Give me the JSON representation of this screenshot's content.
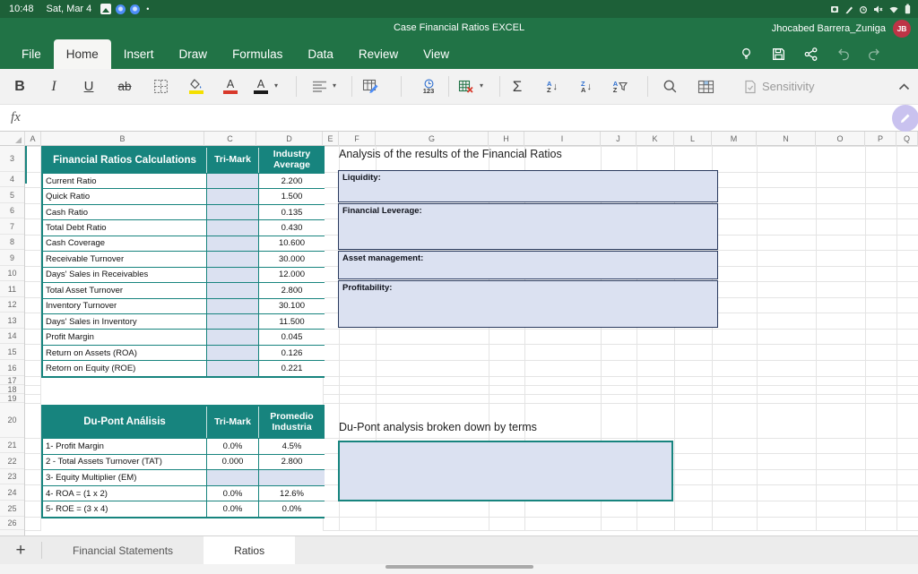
{
  "status_bar": {
    "time": "10:48",
    "date": "Sat, Mar 4"
  },
  "title_bar": {
    "title": "Case Financial Ratios EXCEL",
    "user": "Jhocabed Barrera_Zuniga",
    "avatar": "JB"
  },
  "menu": {
    "items": [
      "File",
      "Home",
      "Insert",
      "Draw",
      "Formulas",
      "Data",
      "Review",
      "View"
    ],
    "active": "Home"
  },
  "toolbar": {
    "bold": "B",
    "italic": "I",
    "underline": "U",
    "strikethrough": "ab",
    "autosum": "Σ",
    "number_format": "123",
    "sensitivity": "Sensitivity",
    "sort_a": "A",
    "sort_z": "Z",
    "arrow_down": "↓",
    "caret": "▾"
  },
  "formula_bar": {
    "fx": "fx"
  },
  "grid": {
    "columns": [
      "A",
      "B",
      "C",
      "D",
      "E",
      "F",
      "G",
      "H",
      "I",
      "J",
      "K",
      "L",
      "M",
      "N",
      "O",
      "P",
      "Q"
    ],
    "rows": [
      "3",
      "4",
      "5",
      "6",
      "7",
      "8",
      "9",
      "10",
      "11",
      "12",
      "13",
      "14",
      "15",
      "16",
      "17",
      "18",
      "19",
      "20",
      "21",
      "22",
      "23",
      "24",
      "25",
      "26"
    ]
  },
  "ratios_table": {
    "title": "Financial Ratios Calculations",
    "col_trimark": "Tri-Mark",
    "col_industry": "Industry Average",
    "rows": [
      {
        "label": "Current Ratio",
        "value": "2.200"
      },
      {
        "label": "Quick Ratio",
        "value": "1.500"
      },
      {
        "label": "Cash Ratio",
        "value": "0.135"
      },
      {
        "label": "Total Debt Ratio",
        "value": "0.430"
      },
      {
        "label": "Cash Coverage",
        "value": "10.600"
      },
      {
        "label": "Receivable Turnover",
        "value": "30.000"
      },
      {
        "label": "Days' Sales in Receivables",
        "value": "12.000"
      },
      {
        "label": "Total Asset Turnover",
        "value": "2.800"
      },
      {
        "label": "Inventory Turnover",
        "value": "30.100"
      },
      {
        "label": "Days' Sales in Inventory",
        "value": "11.500"
      },
      {
        "label": "Profit Margin",
        "value": "0.045"
      },
      {
        "label": "Return on Assets (ROA)",
        "value": "0.126"
      },
      {
        "label": "Retorn on Equity (ROE)",
        "value": "0.221"
      }
    ]
  },
  "analysis": {
    "title": "Analysis of the results of the Financial Ratios",
    "boxes": [
      {
        "label": "Liquidity:"
      },
      {
        "label": "Financial Leverage:"
      },
      {
        "label": "Asset management:"
      },
      {
        "label": "Profitability:"
      }
    ]
  },
  "dupont_table": {
    "title": "Du-Pont Análisis",
    "col_trimark": "Tri-Mark",
    "col_industry": "Promedio Industria",
    "rows": [
      {
        "label": "1- Profit Margin",
        "trimark": "0.0%",
        "industry": "4.5%",
        "highlight": false
      },
      {
        "label": "2 - Total Assets Turnover (TAT)",
        "trimark": "0.000",
        "industry": "2.800",
        "highlight": false
      },
      {
        "label": "3- Equity Multiplier (EM)",
        "trimark": "",
        "industry": "",
        "highlight": true
      },
      {
        "label": "4- ROA = (1 x 2)",
        "trimark": "0.0%",
        "industry": "12.6%",
        "highlight": false
      },
      {
        "label": "5- ROE = (3 x 4)",
        "trimark": "0.0%",
        "industry": "0.0%",
        "highlight": false
      }
    ]
  },
  "dupont_note": {
    "title": "Du-Pont analysis broken down by terms"
  },
  "sheet_tabs": {
    "add": "+",
    "tabs": [
      "Financial Statements",
      "Ratios"
    ],
    "active": "Ratios"
  },
  "colors": {
    "excel_green": "#217346",
    "status_green": "#1D6038",
    "table_teal": "#17847E",
    "cell_lavender": "#DBE1F1",
    "avatar_red": "#BD3446",
    "fill_yellow": "#F4E000",
    "font_red": "#D8392B"
  }
}
